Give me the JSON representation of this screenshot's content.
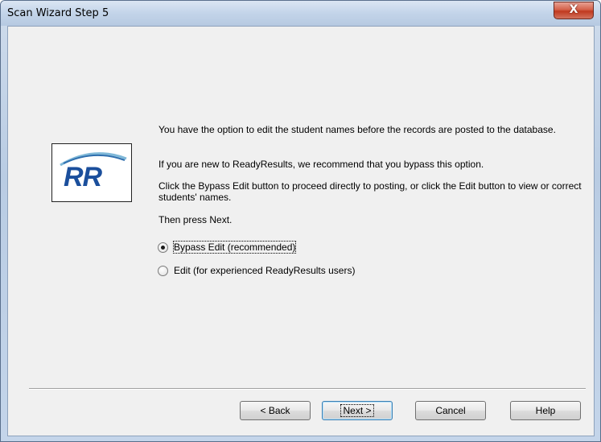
{
  "window": {
    "title": "Scan Wizard Step 5",
    "close_glyph": "X"
  },
  "logo": {
    "text": "RR",
    "icon": "readyresults-logo"
  },
  "instructions": {
    "p1": "You have the option to edit the student names before the records are posted to the database.",
    "p2": "If you are new to ReadyResults, we recommend that you bypass this option.",
    "p3": "Click the Bypass Edit button to proceed directly to posting, or click the Edit button to view or correct students' names.",
    "p4": "Then press Next."
  },
  "options": [
    {
      "label": "Bypass Edit (recommended)",
      "selected": true
    },
    {
      "label": "Edit (for experienced ReadyResults users)",
      "selected": false
    }
  ],
  "buttons": {
    "back": "< Back",
    "next": "Next >",
    "cancel": "Cancel",
    "help": "Help"
  },
  "colors": {
    "logo_blue": "#1b4f9c",
    "close_red": "#c0391f"
  }
}
